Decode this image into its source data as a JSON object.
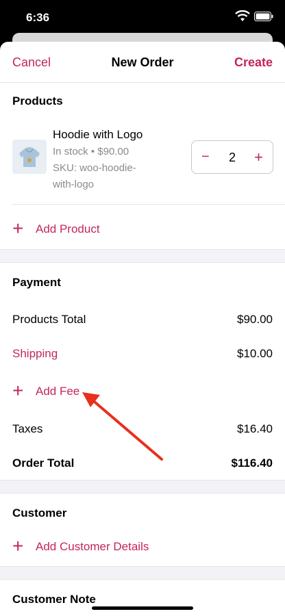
{
  "status": {
    "time": "6:36"
  },
  "nav": {
    "cancel": "Cancel",
    "title": "New Order",
    "create": "Create"
  },
  "products": {
    "section_title": "Products",
    "item": {
      "name": "Hoodie with Logo",
      "meta_line1": "In stock • $90.00",
      "meta_line2": "SKU: woo-hoodie-",
      "meta_line3": "with-logo",
      "quantity": "2",
      "minus": "−",
      "plus": "+"
    },
    "add_product": "Add Product"
  },
  "payment": {
    "section_title": "Payment",
    "products_total_label": "Products Total",
    "products_total_value": "$90.00",
    "shipping_label": "Shipping",
    "shipping_value": "$10.00",
    "add_fee": "Add Fee",
    "taxes_label": "Taxes",
    "taxes_value": "$16.40",
    "order_total_label": "Order Total",
    "order_total_value": "$116.40"
  },
  "customer": {
    "section_title": "Customer",
    "add_details": "Add Customer Details"
  },
  "customer_note": {
    "section_title": "Customer Note"
  },
  "colors": {
    "accent": "#c3255f",
    "arrow": "#e8301c"
  },
  "icons": [
    "wifi-icon",
    "battery-icon",
    "plus-icon",
    "hoodie-thumbnail",
    "annotation-arrow"
  ]
}
